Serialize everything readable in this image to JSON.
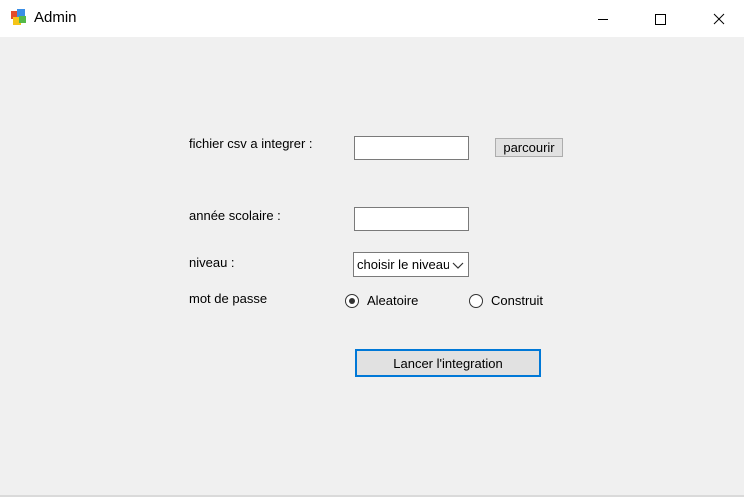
{
  "window": {
    "title": "Admin",
    "icon": "app-form-icon"
  },
  "form": {
    "csv_label": "fichier csv a integrer :",
    "csv_value": "",
    "browse_label": "parcourir",
    "year_label": "année scolaire :",
    "year_value": "",
    "level_label": "niveau :",
    "level_selected": "choisir le niveau",
    "password_label": "mot de passe",
    "password_options": [
      {
        "label": "Aleatoire",
        "checked": true
      },
      {
        "label": "Construit",
        "checked": false
      }
    ],
    "submit_label": "Lancer l'integration"
  },
  "colors": {
    "accent": "#0078d7",
    "window_bg": "#f0f0f0",
    "button_bg": "#e1e1e1"
  }
}
